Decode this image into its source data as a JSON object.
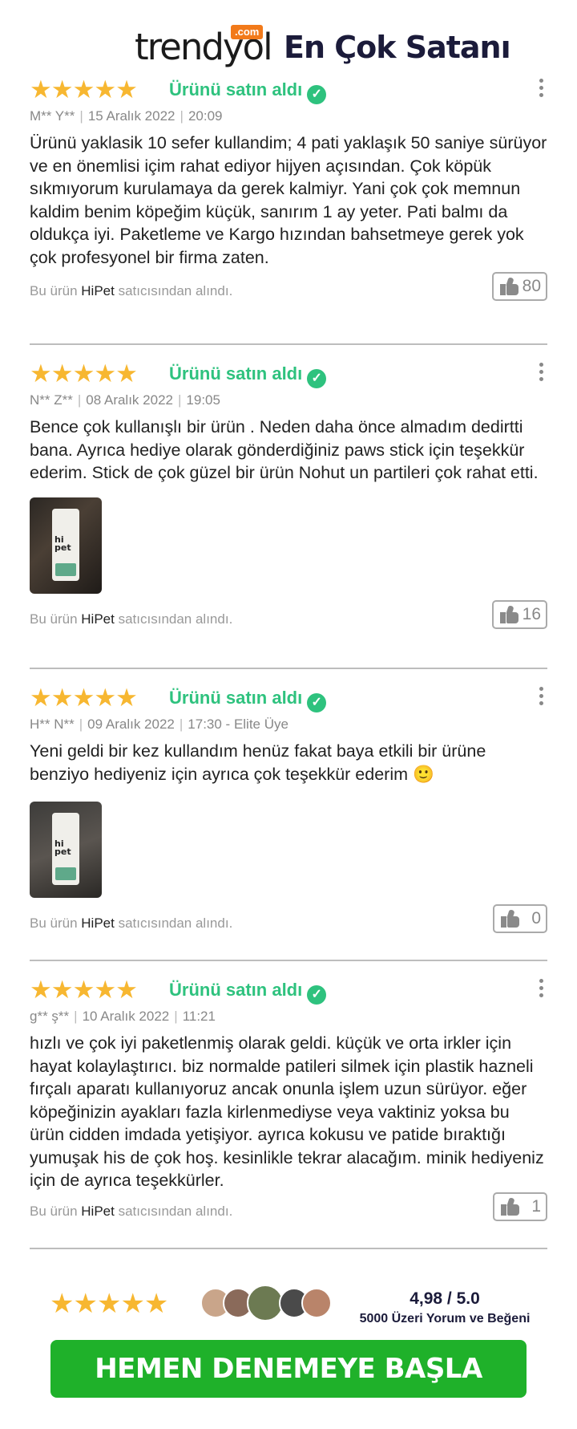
{
  "header": {
    "logo_text": "trendyol",
    "logo_suffix": ".com",
    "title": "En Çok Satanı"
  },
  "colors": {
    "star": "#f7b731",
    "verified_green": "#2ec27e",
    "cta_green": "#1fb12a",
    "brand_orange": "#f27a1a"
  },
  "reviews": [
    {
      "rating": 5,
      "stars": "★★★★★",
      "buyer_label": "Ürünü satın aldı",
      "author": "M** Y**",
      "date": "15 Aralık 2022",
      "time": "20:09",
      "text": "Ürünü yaklasik 10 sefer kullandim; 4 pati yaklaşık 50 saniye sürüyor ve en önemlisi içim rahat ediyor hijyen açısından. Çok köpük sıkmıyorum kurulamaya da gerek kalmiyr. Yani çok çok memnun kaldim benim köpeğim küçük, sanırım 1 ay yeter. Pati balmı da oldukça iyi. Paketleme ve Kargo hızından bahsetmeye gerek yok çok profesyonel bir firma zaten.",
      "seller_prefix": "Bu ürün",
      "seller_name": "HiPet",
      "seller_suffix": "satıcısından alındı.",
      "likes": "80"
    },
    {
      "rating": 5,
      "stars": "★★★★★",
      "buyer_label": "Ürünü satın aldı",
      "author": "N** Z**",
      "date": "08 Aralık 2022",
      "time": "19:05",
      "text": "Bence çok kullanışlı bir ürün . Neden daha önce almadım dedirtti bana. Ayrıca hediye olarak gönderdiğiniz paws stick için teşekkür ederim. Stick de çok güzel bir ürün Nohut un partileri çok rahat etti.",
      "image_label": "hi pet",
      "seller_prefix": "Bu ürün",
      "seller_name": "HiPet",
      "seller_suffix": "satıcısından alındı.",
      "likes": "16"
    },
    {
      "rating": 5,
      "stars": "★★★★★",
      "buyer_label": "Ürünü satın aldı",
      "author": "H** N**",
      "date": "09 Aralık 2022",
      "time": "17:30 - Elite Üye",
      "text": "Yeni geldi bir kez kullandım henüz fakat baya etkili bir ürüne benziyo hediyeniz için ayrıca çok teşekkür ederim 🙂",
      "image_label": "hi pet",
      "seller_prefix": "Bu ürün",
      "seller_name": "HiPet",
      "seller_suffix": "satıcısından alındı.",
      "likes": "0"
    },
    {
      "rating": 5,
      "stars": "★★★★★",
      "buyer_label": "Ürünü satın aldı",
      "author": "g** ş**",
      "date": "10 Aralık 2022",
      "time": "11:21",
      "text": "hızlı ve çok iyi paketlenmiş olarak geldi. küçük ve orta irkler için hayat kolaylaştırıcı. biz normalde patileri silmek için plastik hazneli fırçalı aparatı kullanıyoruz ancak onunla işlem uzun sürüyor. eğer köpeğinizin ayakları fazla kirlenmediyse veya vaktiniz yoksa bu ürün cidden imdada yetişiyor. ayrıca kokusu ve patide bıraktığı yumuşak his de çok hoş. kesinlikle tekrar alacağım. minik hediyeniz için de ayrıca teşekkürler.",
      "seller_prefix": "Bu ürün",
      "seller_name": "HiPet",
      "seller_suffix": "satıcısından alındı.",
      "likes": "1"
    }
  ],
  "summary": {
    "stars": "★★★★★",
    "score": "4,98 / 5.0",
    "subtitle": "5000 Üzeri Yorum ve Beğeni"
  },
  "cta": {
    "label": "HEMEN DENEMEYE BAŞLA"
  }
}
